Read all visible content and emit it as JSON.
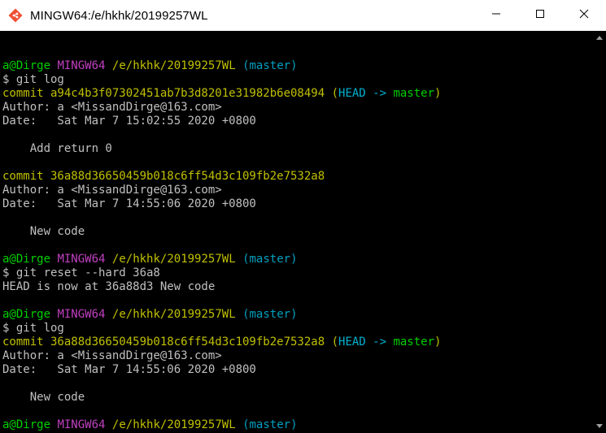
{
  "window": {
    "title": "MINGW64:/e/hkhk/20199257WL",
    "app_icon": "git-bash-icon",
    "controls": {
      "minimize_icon": "minimize-icon",
      "maximize_icon": "maximize-icon",
      "close_icon": "close-icon"
    }
  },
  "colors": {
    "background": "#000000",
    "titlebar": "#ffffff",
    "prompt_user": "#00d000",
    "prompt_env": "#c040c0",
    "prompt_path": "#c0c000",
    "prompt_branch": "#00a0c0",
    "text": "#c0c0c0",
    "commit_hash": "#c0c000",
    "head_ref": "#00b0d0",
    "branch_ref": "#00d000"
  },
  "terminal": {
    "prompt": {
      "user": "a@Dirge",
      "env": "MINGW64",
      "path": "/e/hkhk/20199257WL",
      "branch": "(master)",
      "symbol": "$"
    },
    "lines": [
      {
        "kind": "blank"
      },
      {
        "kind": "prompt"
      },
      {
        "kind": "cmd",
        "text": "$ git log"
      },
      {
        "kind": "commit",
        "prefix": "commit ",
        "hash": "a94c4b3f07302451ab7b3d8201e31982b6e08494",
        "decor_open": " (",
        "head": "HEAD -> ",
        "branch": "master",
        "decor_close": ")"
      },
      {
        "kind": "text",
        "text": "Author: a <MissandDirge@163.com>"
      },
      {
        "kind": "text",
        "text": "Date:   Sat Mar 7 15:02:55 2020 +0800"
      },
      {
        "kind": "blank"
      },
      {
        "kind": "text",
        "text": "    Add return 0"
      },
      {
        "kind": "blank"
      },
      {
        "kind": "commit",
        "prefix": "commit ",
        "hash": "36a88d36650459b018c6ff54d3c109fb2e7532a8",
        "decor_open": "",
        "head": "",
        "branch": "",
        "decor_close": ""
      },
      {
        "kind": "text",
        "text": "Author: a <MissandDirge@163.com>"
      },
      {
        "kind": "text",
        "text": "Date:   Sat Mar 7 14:55:06 2020 +0800"
      },
      {
        "kind": "blank"
      },
      {
        "kind": "text",
        "text": "    New code"
      },
      {
        "kind": "blank"
      },
      {
        "kind": "prompt"
      },
      {
        "kind": "cmd",
        "text": "$ git reset --hard 36a8"
      },
      {
        "kind": "text",
        "text": "HEAD is now at 36a88d3 New code"
      },
      {
        "kind": "blank"
      },
      {
        "kind": "prompt"
      },
      {
        "kind": "cmd",
        "text": "$ git log"
      },
      {
        "kind": "commit",
        "prefix": "commit ",
        "hash": "36a88d36650459b018c6ff54d3c109fb2e7532a8",
        "decor_open": " (",
        "head": "HEAD -> ",
        "branch": "master",
        "decor_close": ")"
      },
      {
        "kind": "text",
        "text": "Author: a <MissandDirge@163.com>"
      },
      {
        "kind": "text",
        "text": "Date:   Sat Mar 7 14:55:06 2020 +0800"
      },
      {
        "kind": "blank"
      },
      {
        "kind": "text",
        "text": "    New code"
      },
      {
        "kind": "blank"
      },
      {
        "kind": "prompt"
      },
      {
        "kind": "cmd",
        "text": "$"
      }
    ]
  }
}
